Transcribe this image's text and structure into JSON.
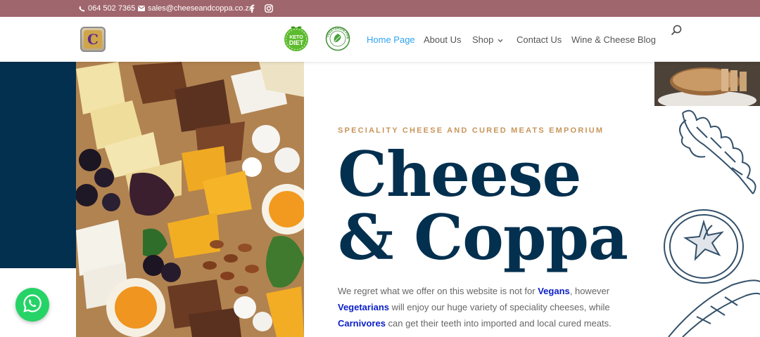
{
  "topbar": {
    "phone": "064 502 7365",
    "email": "sales@cheeseandcoppa.co.za",
    "phone_icon": "phone-icon",
    "email_icon": "envelope-icon",
    "facebook_icon": "facebook-icon",
    "instagram_icon": "instagram-icon",
    "background": "#a0666d"
  },
  "header": {
    "logo_letter": "C",
    "badges": {
      "keto_line1": "KETO",
      "keto_line2": "DIET",
      "vegetarian_text": "VEGETARIAN FRIENDLY"
    },
    "nav": {
      "home": "Home Page",
      "about": "About Us",
      "shop": "Shop",
      "contact": "Contact Us",
      "blog": "Wine & Cheese Blog"
    },
    "active_color": "#2ea3f2"
  },
  "hero": {
    "eyebrow": "SPECIALITY CHEESE AND CURED MEATS EMPORIUM",
    "title_line1": "Cheese",
    "title_line2": "& Coppa",
    "intro": {
      "part1": "We regret what we offer on this website is not for ",
      "vegans": "Vegans",
      "part2": ", however ",
      "vegetarians": "Vegetarians",
      "part3": " will enjoy our huge variety of speciality cheeses, while ",
      "carnivores": "Carnivores",
      "part4": " can get their teeth into imported and local cured meats."
    },
    "title_color": "#04304f",
    "eyebrow_color": "#c7955a",
    "highlight_color": "#0c20c9"
  },
  "whatsapp": {
    "icon": "whatsapp-icon",
    "color": "#25d366"
  }
}
